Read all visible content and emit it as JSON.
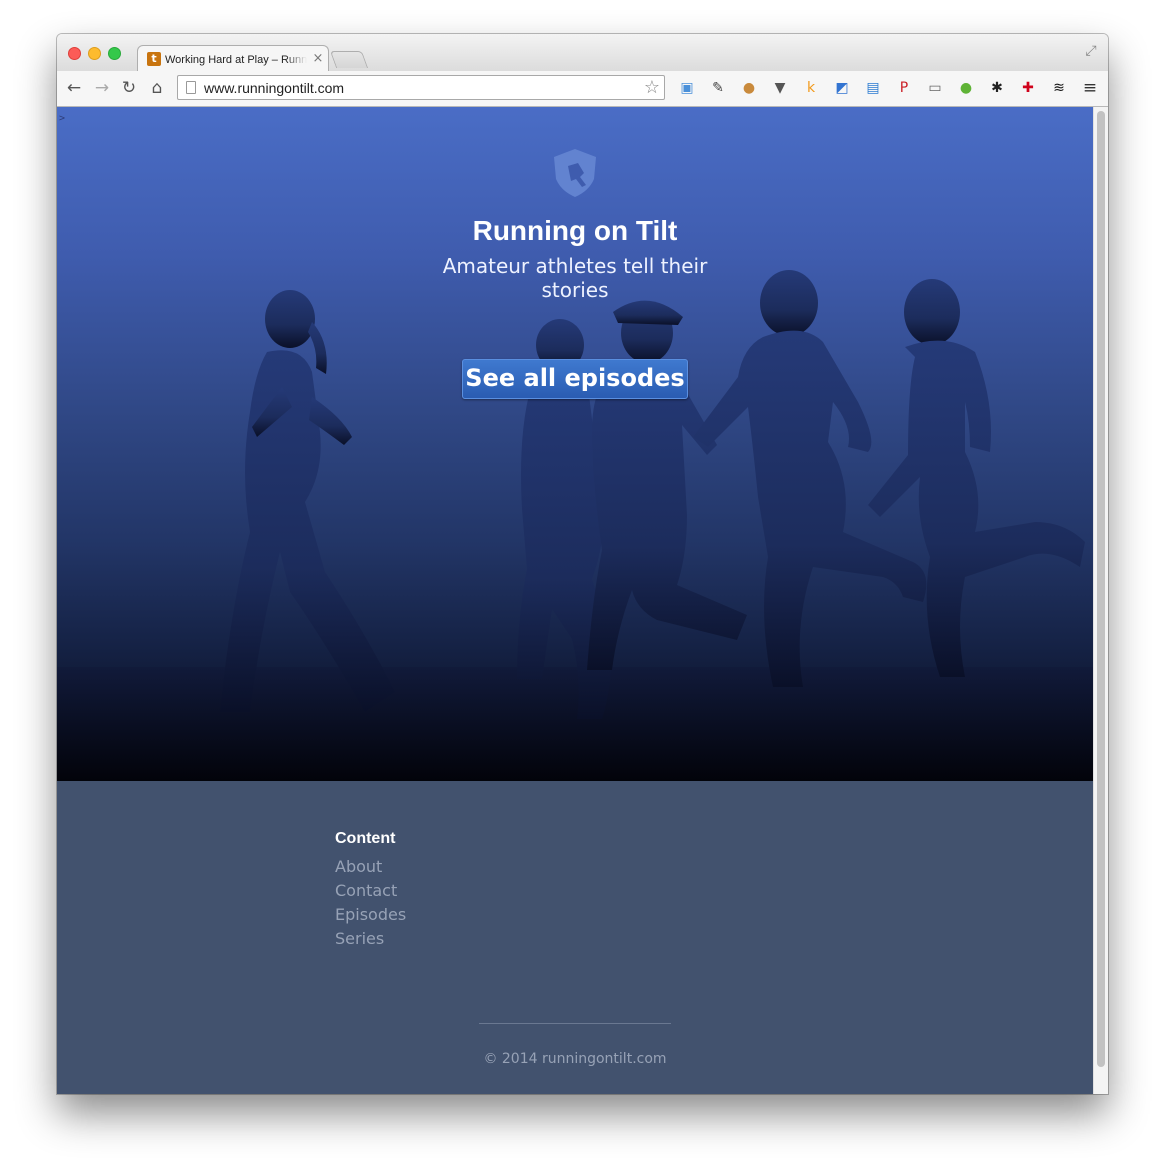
{
  "browser": {
    "tab_title": "Working Hard at Play – Running on Tilt",
    "tab_favicon": "t",
    "tab_close": "×",
    "url": "www.runningontilt.com",
    "nav": {
      "back": "←",
      "forward": "→",
      "reload": "↻",
      "home": "⌂"
    },
    "star": "☆",
    "menu": "≡",
    "extensions": [
      {
        "icon": "window-icon",
        "glyph": "▣",
        "color": "#4a90d9"
      },
      {
        "icon": "wrench-icon",
        "glyph": "✎",
        "color": "#444444"
      },
      {
        "icon": "cookie-icon",
        "glyph": "●",
        "color": "#c98a3c"
      },
      {
        "icon": "pocket-icon",
        "glyph": "▼",
        "color": "#555555"
      },
      {
        "icon": "k-icon",
        "glyph": "k",
        "color": "#f29b1d"
      },
      {
        "icon": "delicious-icon",
        "glyph": "◩",
        "color": "#3274d1"
      },
      {
        "icon": "image-icon",
        "glyph": "▤",
        "color": "#2b7bd1"
      },
      {
        "icon": "pinterest-icon",
        "glyph": "P",
        "color": "#cb2027"
      },
      {
        "icon": "cast-icon",
        "glyph": "▭",
        "color": "#666666"
      },
      {
        "icon": "evernote-icon",
        "glyph": "●",
        "color": "#5fb336"
      },
      {
        "icon": "puzzle-icon",
        "glyph": "✱",
        "color": "#222222"
      },
      {
        "icon": "plus-icon",
        "glyph": "✚",
        "color": "#d0021b"
      },
      {
        "icon": "layers-icon",
        "glyph": "≋",
        "color": "#111111"
      }
    ]
  },
  "hero": {
    "corner_glyph": ">",
    "title": "Running on Tilt",
    "tagline": "Amateur athletes tell their stories",
    "cta_label": "See all episodes"
  },
  "footer": {
    "heading": "Content",
    "links": [
      "About",
      "Contact",
      "Episodes",
      "Series"
    ],
    "copyright": "© 2014 runningontilt.com"
  }
}
